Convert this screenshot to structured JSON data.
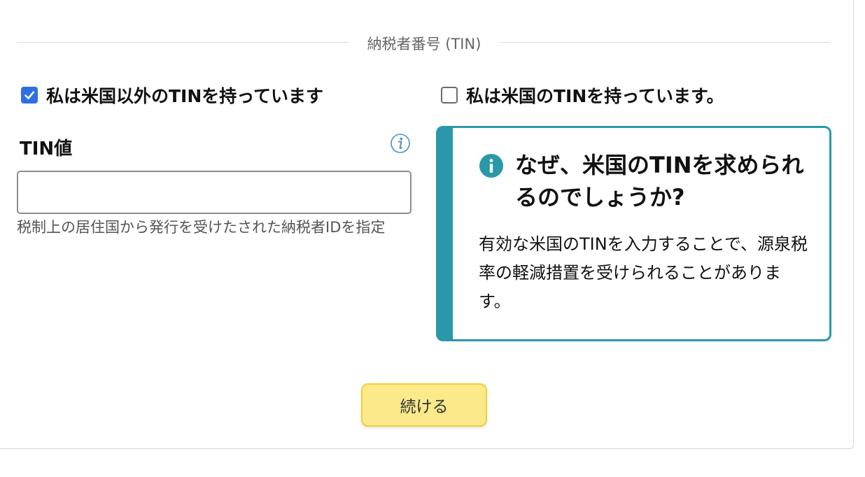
{
  "section": {
    "title": "納税者番号 (TIN)"
  },
  "options": {
    "non_us_tin": {
      "label": "私は米国以外のTINを持っています",
      "checked": true
    },
    "us_tin": {
      "label": "私は米国のTINを持っています。",
      "checked": false
    }
  },
  "tin_field": {
    "label": "TIN値",
    "value": "",
    "placeholder": "",
    "help_text": "税制上の居住国から発行を受けたされた納税者IDを指定"
  },
  "info_box": {
    "title": "なぜ、米国のTINを求められるのでしょうか?",
    "body": "有効な米国のTINを入力することで、源泉税率の軽減措置を受けられることがあります。"
  },
  "buttons": {
    "continue_label": "続ける"
  },
  "colors": {
    "accent": "#2a98a8",
    "checkbox": "#2f6fe0",
    "button_bg": "#fbe98a",
    "button_border": "#f0cf3a"
  },
  "icons": {
    "check": "checkmark-icon",
    "info_small": "info-icon",
    "info_box": "info-circle-icon"
  }
}
